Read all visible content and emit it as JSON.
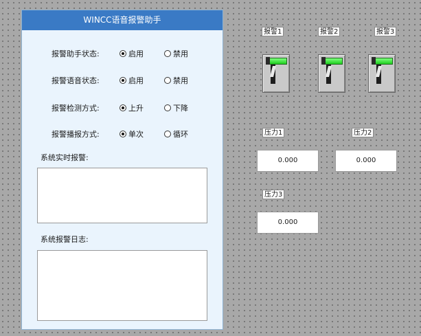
{
  "panel": {
    "title": "WINCC语音报警助手",
    "options": [
      {
        "label": "报警助手状态:",
        "choices": [
          "启用",
          "禁用"
        ],
        "selected": 0
      },
      {
        "label": "报警语音状态:",
        "choices": [
          "启用",
          "禁用"
        ],
        "selected": 0
      },
      {
        "label": "报警检测方式:",
        "choices": [
          "上升",
          "下降"
        ],
        "selected": 0
      },
      {
        "label": "报警播报方式:",
        "choices": [
          "单次",
          "循环"
        ],
        "selected": 0
      }
    ],
    "realtime_label": "系统实时报警:",
    "log_label": "系统报警日志:"
  },
  "alarms": [
    {
      "label": "报警1"
    },
    {
      "label": "报警2"
    },
    {
      "label": "报警3"
    }
  ],
  "pressures": [
    {
      "label": "压力1",
      "value": "0.000"
    },
    {
      "label": "压力2",
      "value": "0.000"
    },
    {
      "label": "压力3",
      "value": "0.000"
    }
  ],
  "colors": {
    "header": "#3a7ac5",
    "switch_indicator": "#2fdc2f"
  }
}
